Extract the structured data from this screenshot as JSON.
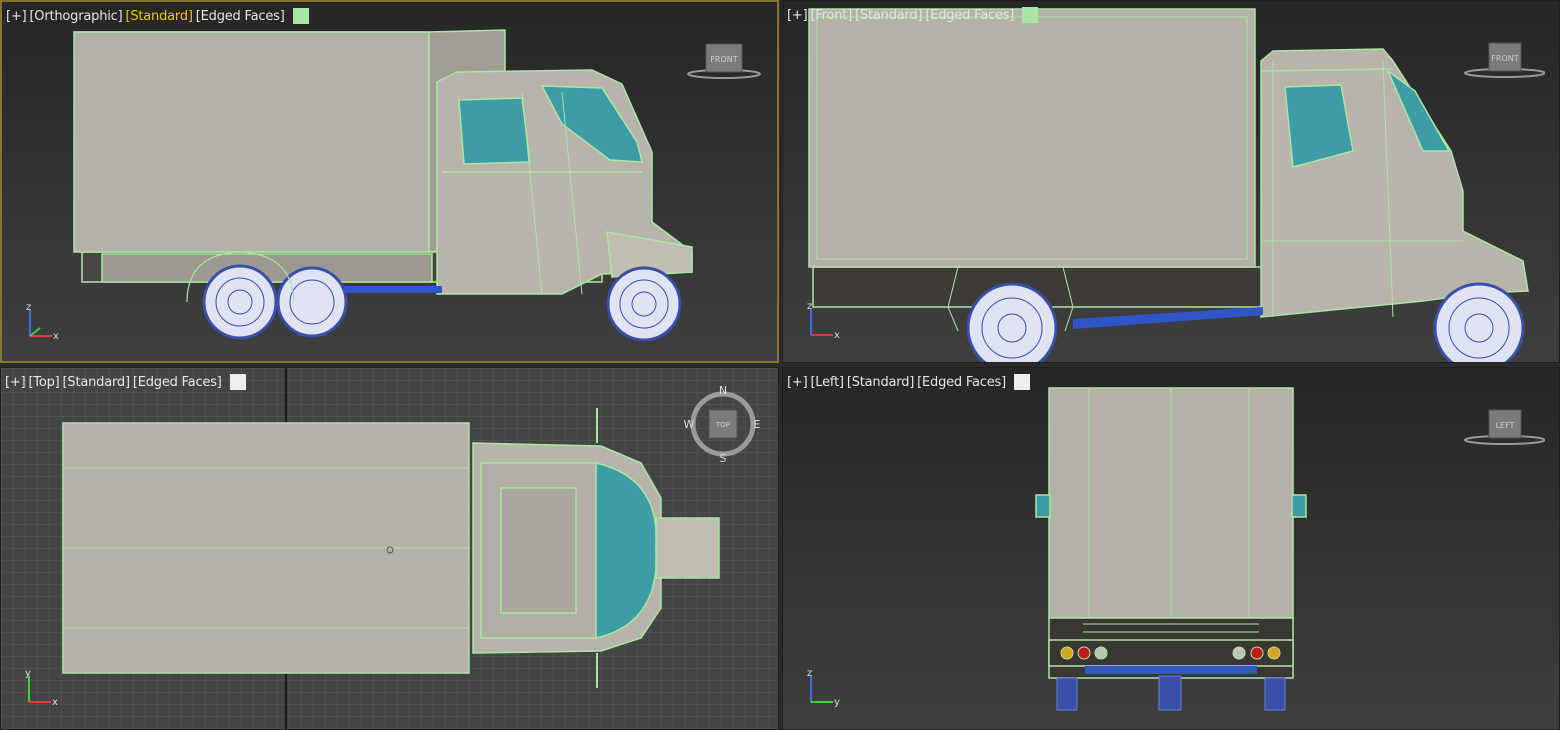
{
  "viewports": {
    "orthographic": {
      "plus": "[+]",
      "view": "[Orthographic]",
      "shading": "[Standard]",
      "edges": "[Edged Faces]",
      "swatch_color": "#a9e6a3",
      "cube_label": "FRONT"
    },
    "front": {
      "plus": "[+]",
      "view": "[Front]",
      "shading": "[Standard]",
      "edges": "[Edged Faces]",
      "swatch_color": "#a9e6a3",
      "cube_label": "FRONT"
    },
    "top": {
      "plus": "[+]",
      "view": "[Top]",
      "shading": "[Standard]",
      "edges": "[Edged Faces]",
      "swatch_color": "#eeeeee",
      "cube_label": "TOP",
      "compass": {
        "n": "N",
        "s": "S",
        "e": "E",
        "w": "W"
      }
    },
    "left": {
      "plus": "[+]",
      "view": "[Left]",
      "shading": "[Standard]",
      "edges": "[Edged Faces]",
      "swatch_color": "#eeeeee",
      "cube_label": "LEFT"
    }
  },
  "axis_labels": {
    "x": "x",
    "y": "y",
    "z": "z"
  },
  "colors": {
    "selection_wire": "#a9e6a3",
    "body": "#b6b1a8",
    "glass": "#3e9ca6",
    "wheel": "#3a4fa8",
    "active_border": "#8a7432",
    "active_label": "#f2c600"
  }
}
